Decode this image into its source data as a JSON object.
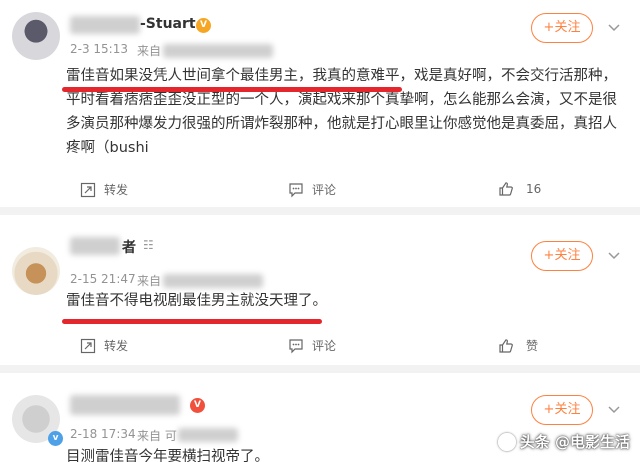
{
  "posts": [
    {
      "username": "-Stuart",
      "time": "2-3 15:13",
      "source_prefix": "来自",
      "follow_label": "+关注",
      "text": "雷佳音如果没凭人世间拿个最佳男主，我真的意难平，戏是真好啊，不会交行活那种，平时看着痞痞歪歪没正型的一个人，演起戏来那个真挚啊，怎么能那么会演，又不是很多演员那种爆发力很强的所谓炸裂那种，他就是打心眼里让你感觉他是真委屈，真招人疼啊（bushi",
      "lines": [
        "雷佳音如果没凭人世间拿个最佳男主，我真的意难平，戏是真好啊，不会交行活那种，",
        "平时看着痞痞歪歪没正型的一个人，演起戏来那个真挚啊，怎么能那么会演，又不是很",
        "多演员那种爆发力很强的所谓炸裂那种，他就是打心眼里让你感觉他是真委屈，真招人",
        "疼啊（bushi"
      ],
      "repost_label": "转发",
      "comment_label": "评论",
      "like_count": "16"
    },
    {
      "username": "者",
      "time": "2-15 21:47",
      "source_prefix": "来自",
      "follow_label": "+关注",
      "text": "雷佳音不得电视剧最佳男主就没天理了。",
      "repost_label": "转发",
      "comment_label": "评论",
      "like_label": "赞"
    },
    {
      "username": "",
      "time": "2-18 17:34",
      "source_prefix": "来自 可",
      "follow_label": "+关注",
      "text": "目测雷佳音今年要横扫视帝了。"
    }
  ],
  "watermark": "头条 @电影生活",
  "colors": {
    "accent": "#ff8140",
    "underline": "#e3272d",
    "badge_gold": "#f6a623"
  },
  "icons": [
    "repost-icon",
    "comment-icon",
    "like-icon",
    "chevron-down-icon",
    "vip-badge-icon"
  ]
}
